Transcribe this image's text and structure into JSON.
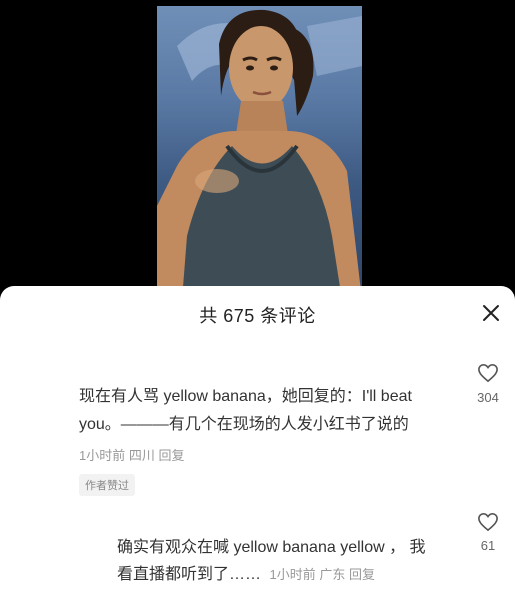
{
  "video": {
    "frame_colors": {
      "top": "#6f8fb7",
      "bottom": "#2d4466"
    }
  },
  "sheet": {
    "title": "共 675 条评论",
    "close_icon": "close-icon"
  },
  "comments": [
    {
      "line1": "现在有人骂 yellow banana，她回复的：I'll beat",
      "line2": "you。———有几个在现场的人发小红书了说的",
      "time": "1小时前",
      "location": "四川",
      "reply_label": "回复",
      "badge": "作者赞过",
      "likes": "304",
      "like_icon": "heart-outline-icon"
    },
    {
      "line1": "确实有观众在喊 yellow banana yellow ， 我",
      "line2": "看直播都听到了……",
      "time": "1小时前",
      "location": "广东",
      "reply_label": "回复",
      "likes": "61",
      "like_icon": "heart-outline-icon"
    }
  ]
}
